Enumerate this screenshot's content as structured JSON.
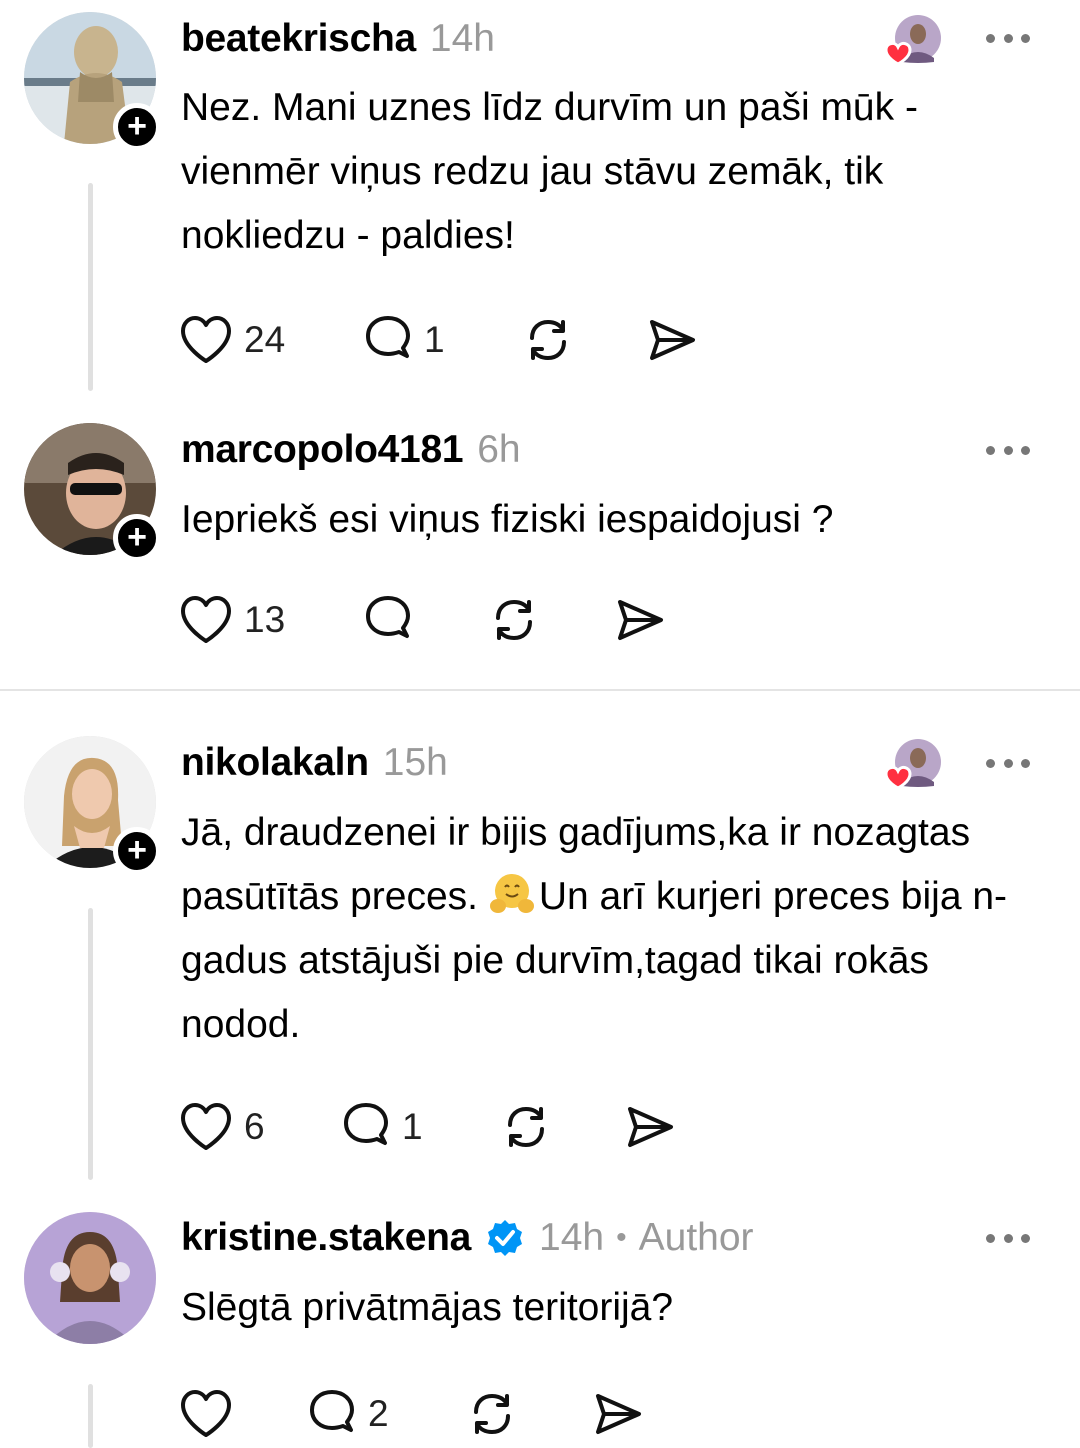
{
  "posts": [
    {
      "username": "beatekrischa",
      "time": "14h",
      "text": "Nez. Mani uznes līdz durvīm un paši mūk - vienmēr viņus redzu jau stāvu zemāk, tik nokliedzu - paldies!",
      "likes": "24",
      "replies": "1",
      "author_liked": true
    },
    {
      "username": "marcopolo4181",
      "time": "6h",
      "text": "Iepriekš esi viņus fiziski iespaidojusi ?",
      "likes": "13",
      "replies": ""
    },
    {
      "username": "nikolakaln",
      "time": "15h",
      "text_before_emoji": "Jā, draudzenei ir bijis gadījums,ka ir nozagtas pasūtītās preces. ",
      "emoji": "hugging-face-emoji",
      "text_after_emoji": "Un arī kurjeri preces bija n-gadus atstājuši pie durvīm,tagad tikai rokās nodod.",
      "likes": "6",
      "replies": "1",
      "author_liked": true
    },
    {
      "username": "kristine.stakena",
      "verified": true,
      "time": "14h",
      "separator": "•",
      "role": "Author",
      "text": "Slēgtā privātmājas teritorijā?",
      "likes": "",
      "replies": "2"
    }
  ],
  "icons": {
    "like": "heart-outline-icon",
    "reply": "speech-bubble-icon",
    "repost": "repost-arrows-icon",
    "share": "send-icon",
    "more": "more-dots-icon",
    "follow": "plus-icon",
    "verified": "verified-badge-icon"
  },
  "colors": {
    "verified_blue": "#0095f6",
    "heart_red": "#ff3040",
    "muted_text": "#999999"
  }
}
